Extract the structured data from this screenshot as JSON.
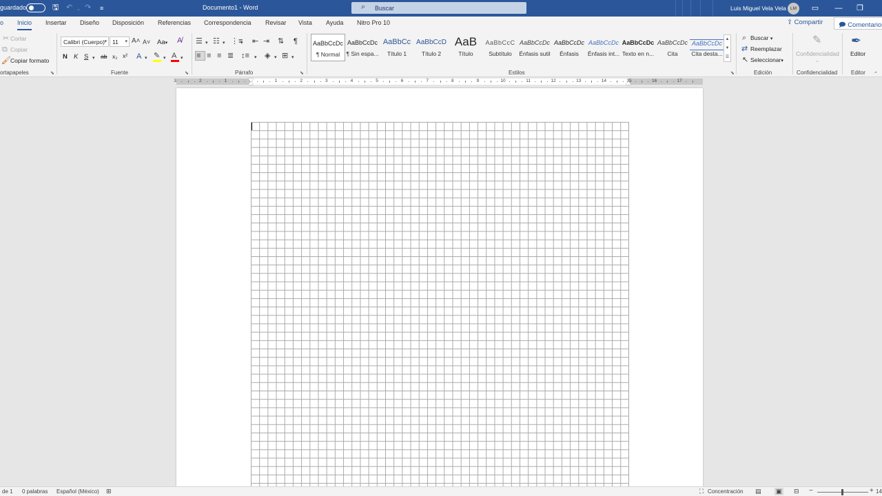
{
  "titlebar": {
    "autosave_label": "guardado",
    "doc_title": "Documento1  -  Word",
    "search_placeholder": "Buscar",
    "user_name": "Luis Miguel Vela Vela",
    "user_initials": "LM"
  },
  "tabs": [
    {
      "label": "Inicio",
      "active": true
    },
    {
      "label": "Insertar"
    },
    {
      "label": "Diseño"
    },
    {
      "label": "Disposición"
    },
    {
      "label": "Referencias"
    },
    {
      "label": "Correspondencia"
    },
    {
      "label": "Revisar"
    },
    {
      "label": "Vista"
    },
    {
      "label": "Ayuda"
    },
    {
      "label": "Nitro Pro 10"
    }
  ],
  "share_label": "Compartir",
  "comments_label": "Comentarios",
  "clipboard": {
    "cut": "Cortar",
    "copy": "Copiar",
    "format_painter": "Copiar formato",
    "group_label": "ortapapeles"
  },
  "font": {
    "family": "Calibri (Cuerpo)",
    "size": "11",
    "case_label": "Aa",
    "bold": "N",
    "italic": "K",
    "underline": "S",
    "strike": "ab",
    "subscript": "x₂",
    "superscript": "x²",
    "group_label": "Fuente"
  },
  "paragraph": {
    "pilcrow": "¶",
    "group_label": "Párrafo"
  },
  "styles": {
    "group_label": "Estilos",
    "items": [
      {
        "preview": "AaBbCcDc",
        "name": "¶ Normal",
        "selected": true
      },
      {
        "preview": "AaBbCcDc",
        "name": "¶ Sin espa..."
      },
      {
        "preview": "AaBbCc",
        "name": "Título 1"
      },
      {
        "preview": "AaBbCcD",
        "name": "Título 2"
      },
      {
        "preview": "AaB",
        "name": "Título"
      },
      {
        "preview": "AaBbCcC",
        "name": "Subtítulo"
      },
      {
        "preview": "AaBbCcDc",
        "name": "Énfasis sutil"
      },
      {
        "preview": "AaBbCcDc",
        "name": "Énfasis"
      },
      {
        "preview": "AaBbCcDc",
        "name": "Énfasis int..."
      },
      {
        "preview": "AaBbCcDc",
        "name": "Texto en n..."
      },
      {
        "preview": "AaBbCcDc",
        "name": "Cita"
      },
      {
        "preview": "AaBbCcDc",
        "name": "Cita desta..."
      }
    ]
  },
  "editing": {
    "find": "Buscar",
    "replace": "Reemplazar",
    "select": "Seleccionar",
    "group_label": "Edición"
  },
  "sensitivity": {
    "button": "Confidencialidad",
    "group_label": "Confidencialidad"
  },
  "editor": {
    "button": "Editor",
    "group_label": "Editor"
  },
  "ruler": {
    "numbers": [
      "3",
      "2",
      "1",
      "1",
      "2",
      "3",
      "4",
      "5",
      "6",
      "7",
      "8",
      "9",
      "10",
      "11",
      "12",
      "13",
      "14",
      "15",
      "16",
      "17"
    ]
  },
  "status": {
    "page": "de 1",
    "words": "0 palabras",
    "language": "Español (México)",
    "focus": "Concentración",
    "zoom": "14"
  },
  "colors": {
    "word_blue": "#2b579a",
    "ribbon_bg": "#f3f3f3",
    "canvas_bg": "#e6e6e6"
  }
}
